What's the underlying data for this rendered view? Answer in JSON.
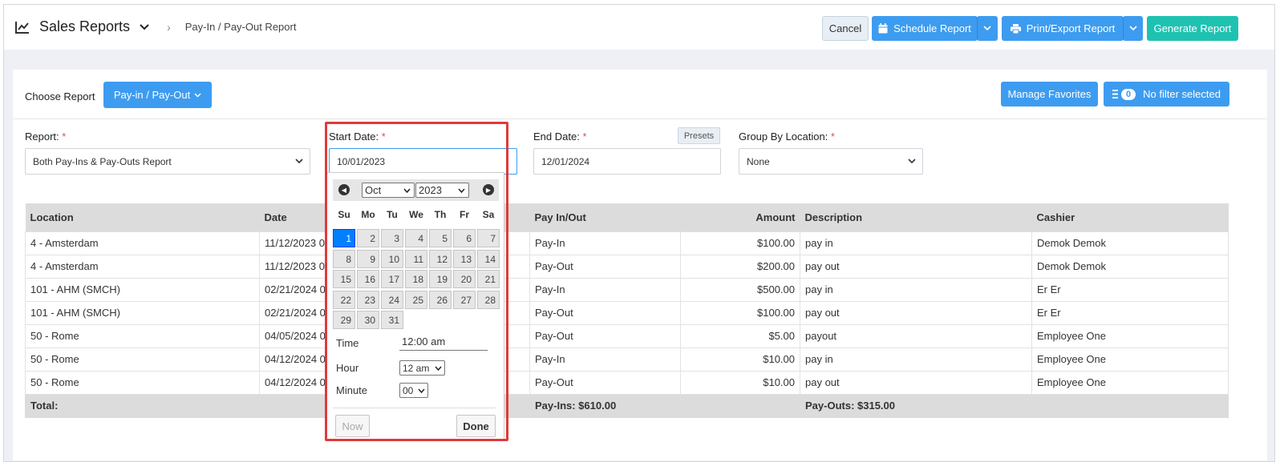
{
  "header": {
    "title": "Sales Reports",
    "breadcrumb": "Pay-In / Pay-Out Report",
    "cancel_label": "Cancel",
    "schedule_label": "Schedule Report",
    "print_label": "Print/Export Report",
    "generate_label": "Generate Report"
  },
  "toolbar": {
    "choose_label": "Choose Report",
    "report_button": "Pay-in / Pay-Out",
    "favorites_label": "Manage Favorites",
    "filter_count": "0",
    "filter_label": "No filter selected"
  },
  "filters": {
    "report_label": "Report:",
    "report_value": "Both Pay-Ins & Pay-Outs Report",
    "start_label": "Start Date:",
    "start_value": "10/01/2023",
    "end_label": "End Date:",
    "end_value": "12/01/2024",
    "presets_label": "Presets",
    "group_label": "Group By Location:",
    "group_value": "None",
    "required_mark": "*"
  },
  "table": {
    "headers": [
      "Location",
      "Date",
      "Pay In/Out",
      "Amount",
      "Description",
      "Cashier"
    ],
    "rows": [
      [
        "4 - Amsterdam",
        "11/12/2023 0",
        "Pay-In",
        "$100.00",
        "pay in",
        "Demok Demok"
      ],
      [
        "4 - Amsterdam",
        "11/12/2023 0",
        "Pay-Out",
        "$200.00",
        "pay out",
        "Demok Demok"
      ],
      [
        "101 - AHM (SMCH)",
        "02/21/2024 0",
        "Pay-In",
        "$500.00",
        "pay in",
        "Er Er"
      ],
      [
        "101 - AHM (SMCH)",
        "02/21/2024 0",
        "Pay-Out",
        "$100.00",
        "pay out",
        "Er Er"
      ],
      [
        "50 - Rome",
        "04/05/2024 0",
        "Pay-Out",
        "$5.00",
        "payout",
        "Employee One"
      ],
      [
        "50 - Rome",
        "04/12/2024 0",
        "Pay-In",
        "$10.00",
        "pay in",
        "Employee One"
      ],
      [
        "50 - Rome",
        "04/12/2024 0",
        "Pay-Out",
        "$10.00",
        "pay out",
        "Employee One"
      ]
    ],
    "total_label": "Total:",
    "total_payins": "Pay-Ins: $610.00",
    "total_payouts": "Pay-Outs: $315.00"
  },
  "datepicker": {
    "month": "Oct",
    "year": "2023",
    "weekdays": [
      "Su",
      "Mo",
      "Tu",
      "We",
      "Th",
      "Fr",
      "Sa"
    ],
    "start_offset": 0,
    "days_in_month": 31,
    "selected_day": 1,
    "time_label": "Time",
    "time_value": "12:00 am",
    "hour_label": "Hour",
    "hour_value": "12 am",
    "minute_label": "Minute",
    "minute_value": "00",
    "now_label": "Now",
    "done_label": "Done"
  }
}
